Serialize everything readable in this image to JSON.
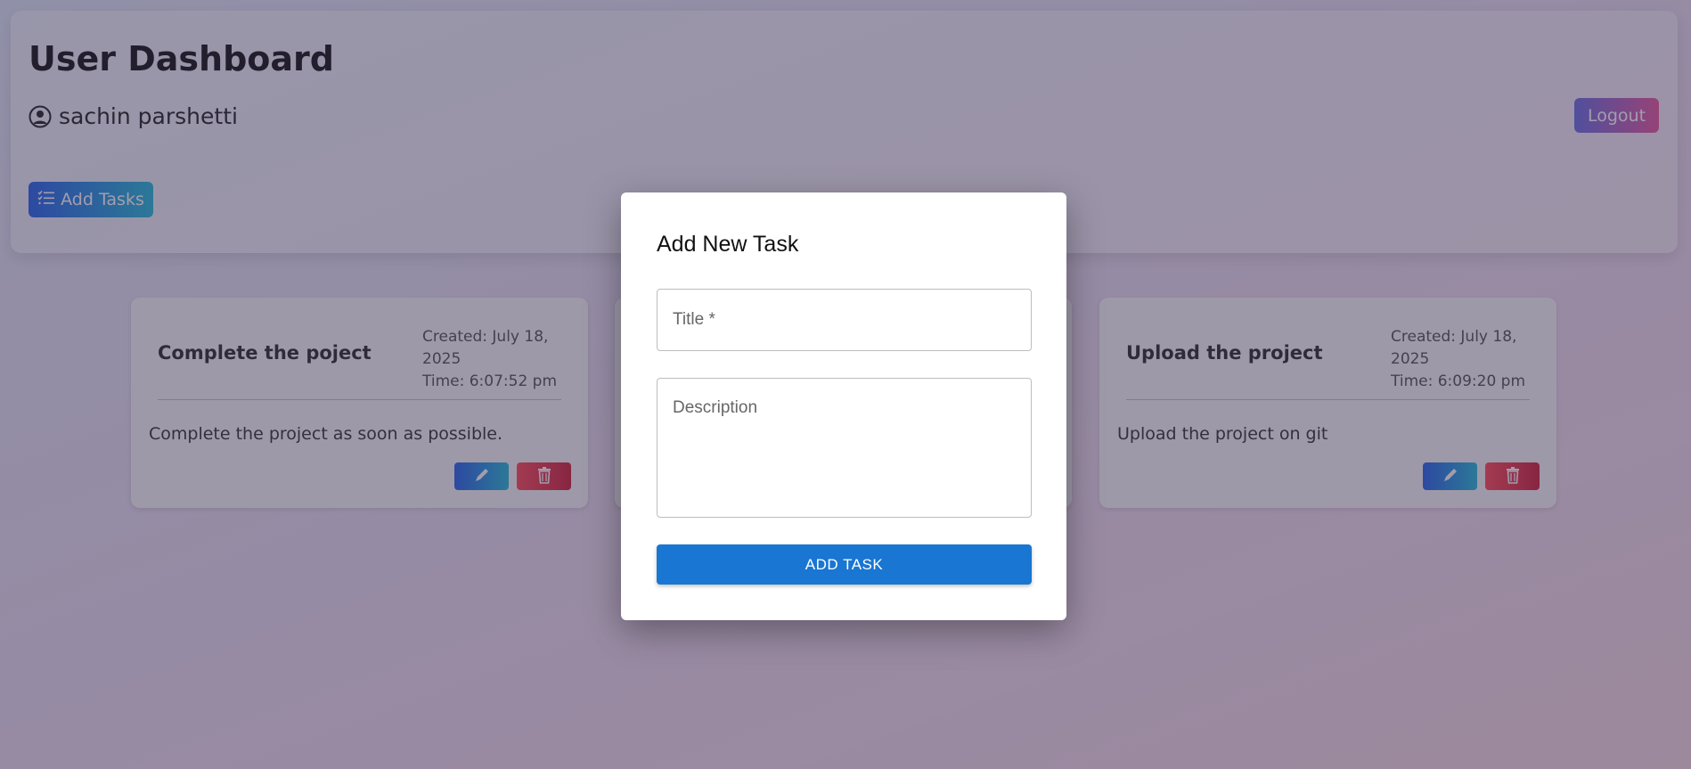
{
  "header": {
    "title": "User Dashboard",
    "username": "sachin parshetti",
    "logout_label": "Logout",
    "add_tasks_label": "Add Tasks"
  },
  "tasks": [
    {
      "title": "Complete the poject",
      "created": "Created: July 18, 2025",
      "time": "Time: 6:07:52 pm",
      "description": "Complete the project as soon as possible."
    },
    {
      "title": "Upload the project",
      "created": "Created: July 18, 2025",
      "time": "Time: 6:09:20 pm",
      "description": "Upload the project on git"
    }
  ],
  "modal": {
    "title": "Add New Task",
    "title_placeholder": "Title *",
    "description_placeholder": "Description",
    "submit_label": "ADD TASK"
  },
  "icons": {
    "user": "user-circle-icon",
    "add_tasks": "list-icon",
    "edit": "pencil-icon",
    "delete": "trash-icon"
  },
  "colors": {
    "primary_gradient_start": "#1557e8",
    "primary_gradient_end": "#12b5d6",
    "logout_gradient_start": "#5b63e0",
    "logout_gradient_end": "#e74a95",
    "delete_gradient_start": "#ff3b4a",
    "delete_gradient_end": "#c9102a",
    "modal_button": "#1976d2"
  }
}
